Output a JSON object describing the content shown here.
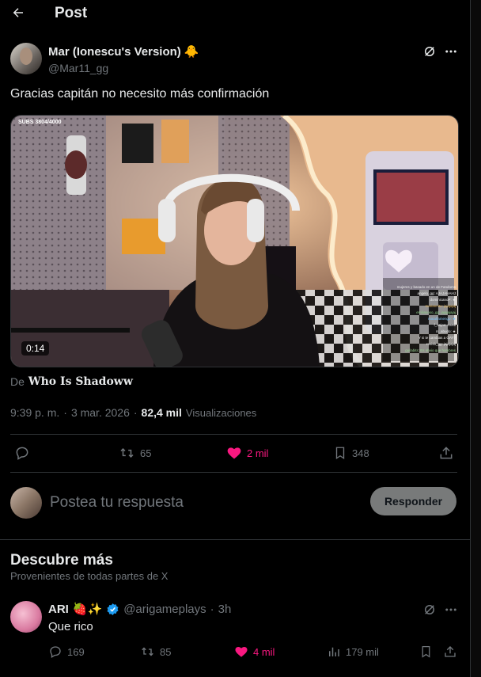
{
  "header": {
    "title": "Post"
  },
  "post": {
    "author_name": "Mar (Ionescu's Version)",
    "author_emoji": "🐥",
    "handle": "@Mar11_gg",
    "text": "Gracias capitán no necesito más confirmación",
    "video": {
      "overlay_subs": "SUBS 3804/4000",
      "duration": "0:14",
      "chat_lines": [
        "mujeres y basado en un de Fandoms",
        "angelo_gg: AJAJAHAHJ",
        "dominicanoP: ★",
        "mariannito: jajajajaj",
        "emiliaxoxo_gg: jajajajajaj",
        "mataflamengo: ★",
        "f_anjos: Gusti",
        "m_abudo: ★",
        "Y si te cambias a GAY?",
        "rosisb_gg: jajajajaj",
        "guilabits: Es obvio que hombres"
      ]
    },
    "source_prefix": "De",
    "source_name": "Who Is Shadoww",
    "time": "9:39 p. m.",
    "sep": "·",
    "date": "3 mar. 2026",
    "views_count": "82,4 mil",
    "views_label": "Visualizaciones",
    "retweets": "65",
    "likes": "2 mil",
    "bookmarks": "348"
  },
  "reply": {
    "placeholder": "Postea tu respuesta",
    "button": "Responder"
  },
  "discover": {
    "title": "Descubre más",
    "subtitle": "Provenientes de todas partes de X",
    "item": {
      "name": "ARI",
      "emojis": "🍓✨",
      "handle": "@arigameplays",
      "sep": "·",
      "time": "3h",
      "text": "Que rico",
      "replies": "169",
      "retweets": "85",
      "likes": "4 mil",
      "views": "179 mil"
    }
  },
  "colors": {
    "like": "#f91880",
    "verified": "#1d9bf0",
    "text": "#e7e9ea",
    "muted": "#71767b",
    "border": "#2f3336"
  }
}
